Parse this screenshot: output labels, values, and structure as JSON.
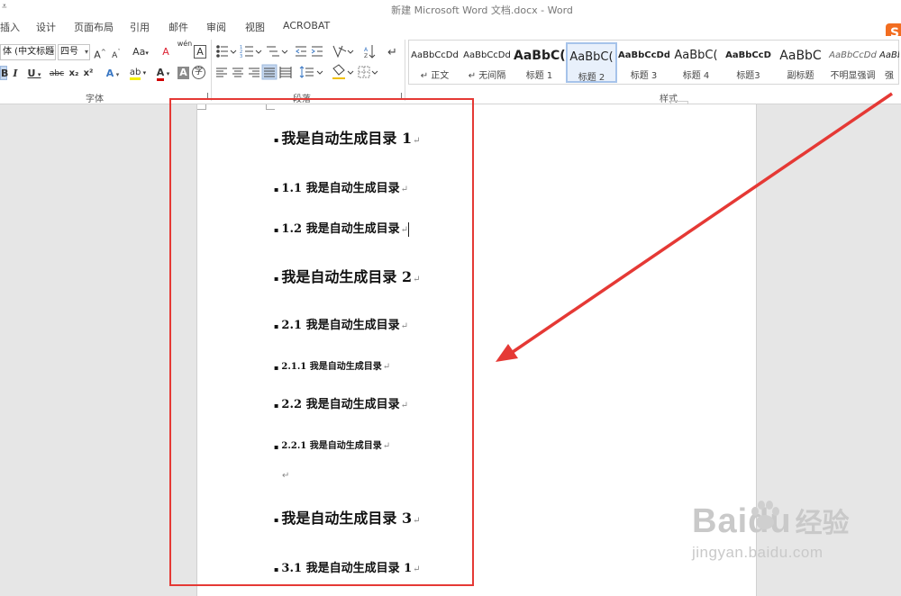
{
  "window": {
    "title": "新建 Microsoft Word 文档.docx - Word",
    "qat_glyph": "⩡"
  },
  "menu": [
    "插入",
    "设计",
    "页面布局",
    "引用",
    "邮件",
    "审阅",
    "视图",
    "ACROBAT"
  ],
  "ribbon": {
    "font": {
      "font_name": "体 (中文标题",
      "font_size": "四号",
      "grow": "A",
      "shrink": "A",
      "change_case": "Aa",
      "clear_format": "A",
      "phonetic": "wén",
      "border_char": "A",
      "bold": "B",
      "italic": "I",
      "underline": "U",
      "strikethrough": "abc",
      "subscript": "x₂",
      "superscript": "x²",
      "text_effect": "A",
      "highlight": "ab",
      "font_color": "A",
      "shading": "A",
      "enclose": "字",
      "label": "字体"
    },
    "paragraph": {
      "label": "段落"
    },
    "styles": {
      "label": "样式",
      "items": [
        {
          "preview": "AaBbCcDd",
          "name": "↵ 正文"
        },
        {
          "preview": "AaBbCcDd",
          "name": "↵ 无间隔"
        },
        {
          "preview": "AaBbC(",
          "name": "标题 1"
        },
        {
          "preview": "AaBbC(",
          "name": "标题 2"
        },
        {
          "preview": "AaBbCcDd",
          "name": "标题 3"
        },
        {
          "preview": "AaBbC(",
          "name": "标题 4"
        },
        {
          "preview": "AaBbCcD",
          "name": "标题3"
        },
        {
          "preview": "AaBbC",
          "name": "副标题"
        },
        {
          "preview": "AaBbCcDd",
          "name": "不明显强调"
        },
        {
          "preview": "AaBb",
          "name": "强"
        }
      ]
    }
  },
  "sogou_icon": "S",
  "document": {
    "bullet": "▪",
    "para_mark": "↵",
    "lines": [
      {
        "text": "我是自动生成目录 1",
        "level": 1
      },
      {
        "text": "1.1 我是自动生成目录",
        "level": 2
      },
      {
        "text": "1.2 我是自动生成目录",
        "level": 2
      },
      {
        "text": "我是自动生成目录 2",
        "level": 1
      },
      {
        "text": "2.1 我是自动生成目录",
        "level": 2
      },
      {
        "text": "2.1.1 我是自动生成目录",
        "level": 3
      },
      {
        "text": "2.2 我是自动生成目录",
        "level": 2
      },
      {
        "text": "2.2.1 我是自动生成目录",
        "level": 3
      },
      {
        "text": "我是自动生成目录 3",
        "level": 1
      },
      {
        "text": "3.1 我是自动生成目录 1",
        "level": 2
      }
    ]
  },
  "watermark": {
    "brand": "Baidu",
    "cn": "经验",
    "url": "jingyan.baidu.com"
  },
  "colors": {
    "annotation_red": "#e53935",
    "selected_style": "#a6c3ea",
    "page": "#ffffff",
    "workspace": "#e6e6e6"
  }
}
